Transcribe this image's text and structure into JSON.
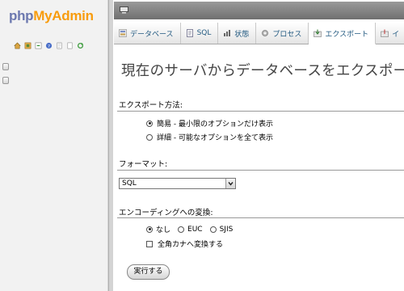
{
  "logo": {
    "part1": "php",
    "part2": "MyAdmin"
  },
  "tabs": [
    {
      "label": "データベース",
      "icon": "database-icon"
    },
    {
      "label": "SQL",
      "icon": "sql-icon"
    },
    {
      "label": "状態",
      "icon": "status-icon"
    },
    {
      "label": "プロセス",
      "icon": "process-icon"
    },
    {
      "label": "エクスポート",
      "icon": "export-icon"
    },
    {
      "label": "イ",
      "icon": "import-icon"
    }
  ],
  "page_title": "現在のサーバからデータベースをエクスポート",
  "export_method": {
    "label": "エクスポート方法:",
    "options": [
      "簡易 - 最小限のオプションだけ表示",
      "詳細 - 可能なオプションを全て表示"
    ],
    "selected": 0
  },
  "format": {
    "label": "フォーマット:",
    "value": "SQL"
  },
  "encoding": {
    "label": "エンコーディングへの変換:",
    "options": [
      "なし",
      "EUC",
      "SJIS"
    ],
    "selected": 0,
    "checkbox_label": "全角カナへ変換する"
  },
  "submit_label": "実行する",
  "colors": {
    "logo_php": "#6c78af",
    "logo_myadmin": "#f89c0e",
    "link": "#235a81"
  }
}
